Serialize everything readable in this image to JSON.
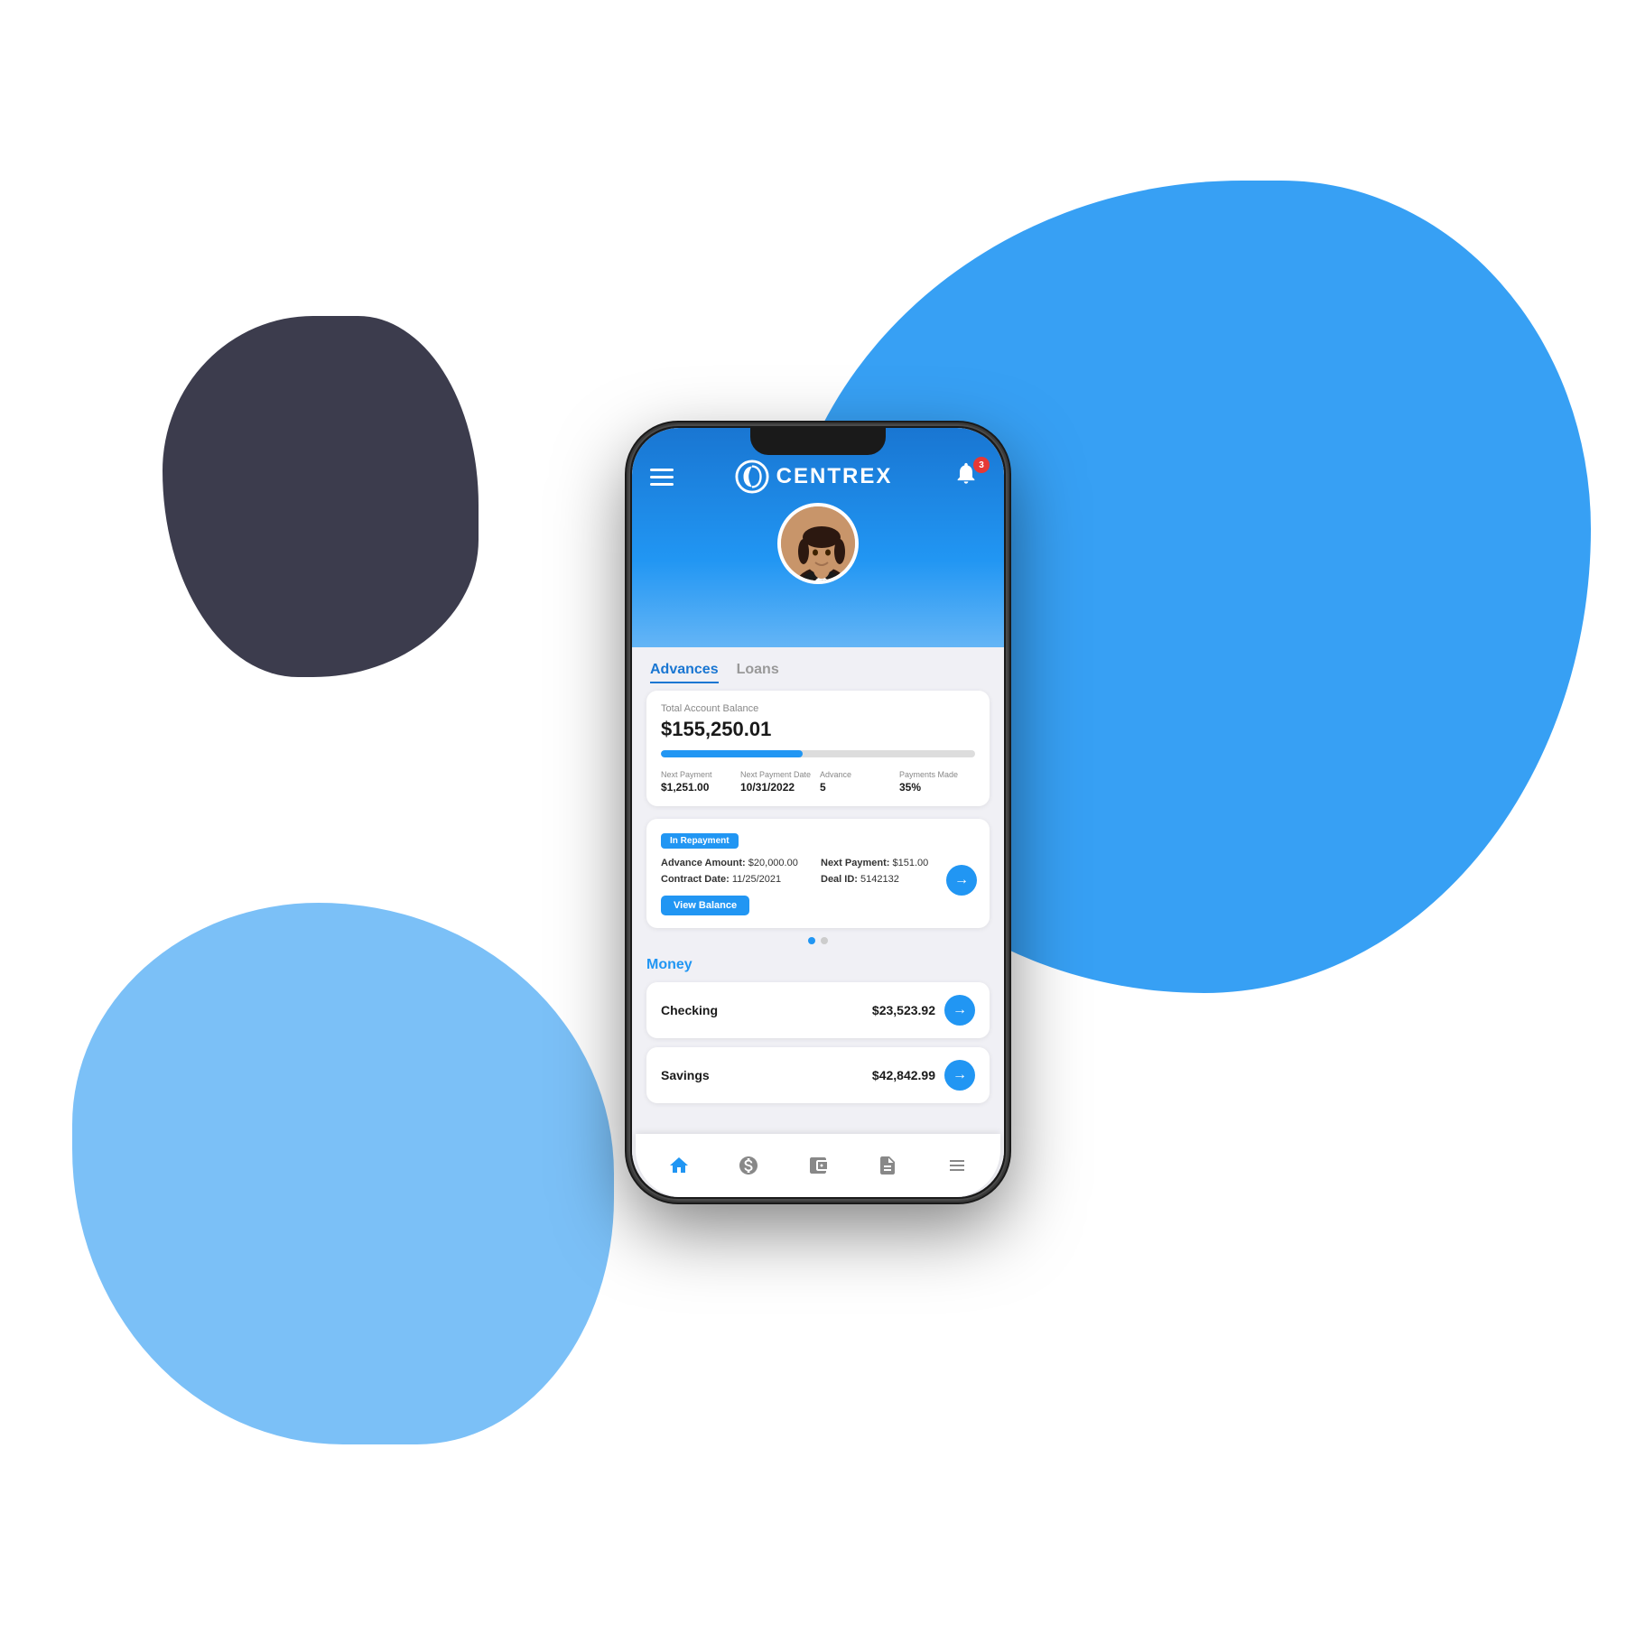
{
  "background": {
    "blob_colors": [
      "#2196F3",
      "#64B5F6",
      "#1a1a2e"
    ]
  },
  "app": {
    "logo_text": "CENTREX",
    "notification_count": "3",
    "tabs": [
      {
        "id": "advances",
        "label": "Advances",
        "active": true
      },
      {
        "id": "loans",
        "label": "Loans",
        "active": false
      }
    ],
    "balance_card": {
      "label": "Total Account Balance",
      "amount": "$155,250.01",
      "progress_percent": 45,
      "stats": [
        {
          "label": "Next Payment",
          "value": "$1,251.00"
        },
        {
          "label": "Next Payment Date",
          "value": "10/31/2022"
        },
        {
          "label": "Advance",
          "value": "5"
        },
        {
          "label": "Payments Made",
          "value": "35%"
        }
      ]
    },
    "deal_card": {
      "badge": "In Repayment",
      "advance_amount_label": "Advance Amount:",
      "advance_amount": "$20,000.00",
      "next_payment_label": "Next Payment:",
      "next_payment": "$151.00",
      "contract_date_label": "Contract Date:",
      "contract_date": "11/25/2021",
      "deal_id_label": "Deal ID:",
      "deal_id": "5142132",
      "view_balance_btn": "View Balance"
    },
    "dots": [
      {
        "active": true
      },
      {
        "active": false
      }
    ],
    "money_section": {
      "title": "Money",
      "accounts": [
        {
          "label": "Checking",
          "amount": "$23,523.92"
        },
        {
          "label": "Savings",
          "amount": "$42,842.99"
        }
      ]
    },
    "nav": [
      {
        "id": "home",
        "icon": "⌂",
        "active": true
      },
      {
        "id": "pay",
        "icon": "🤲",
        "active": false
      },
      {
        "id": "wallet",
        "icon": "👛",
        "active": false
      },
      {
        "id": "doc",
        "icon": "📄",
        "active": false
      },
      {
        "id": "tasks",
        "icon": "≡",
        "active": false
      }
    ]
  }
}
